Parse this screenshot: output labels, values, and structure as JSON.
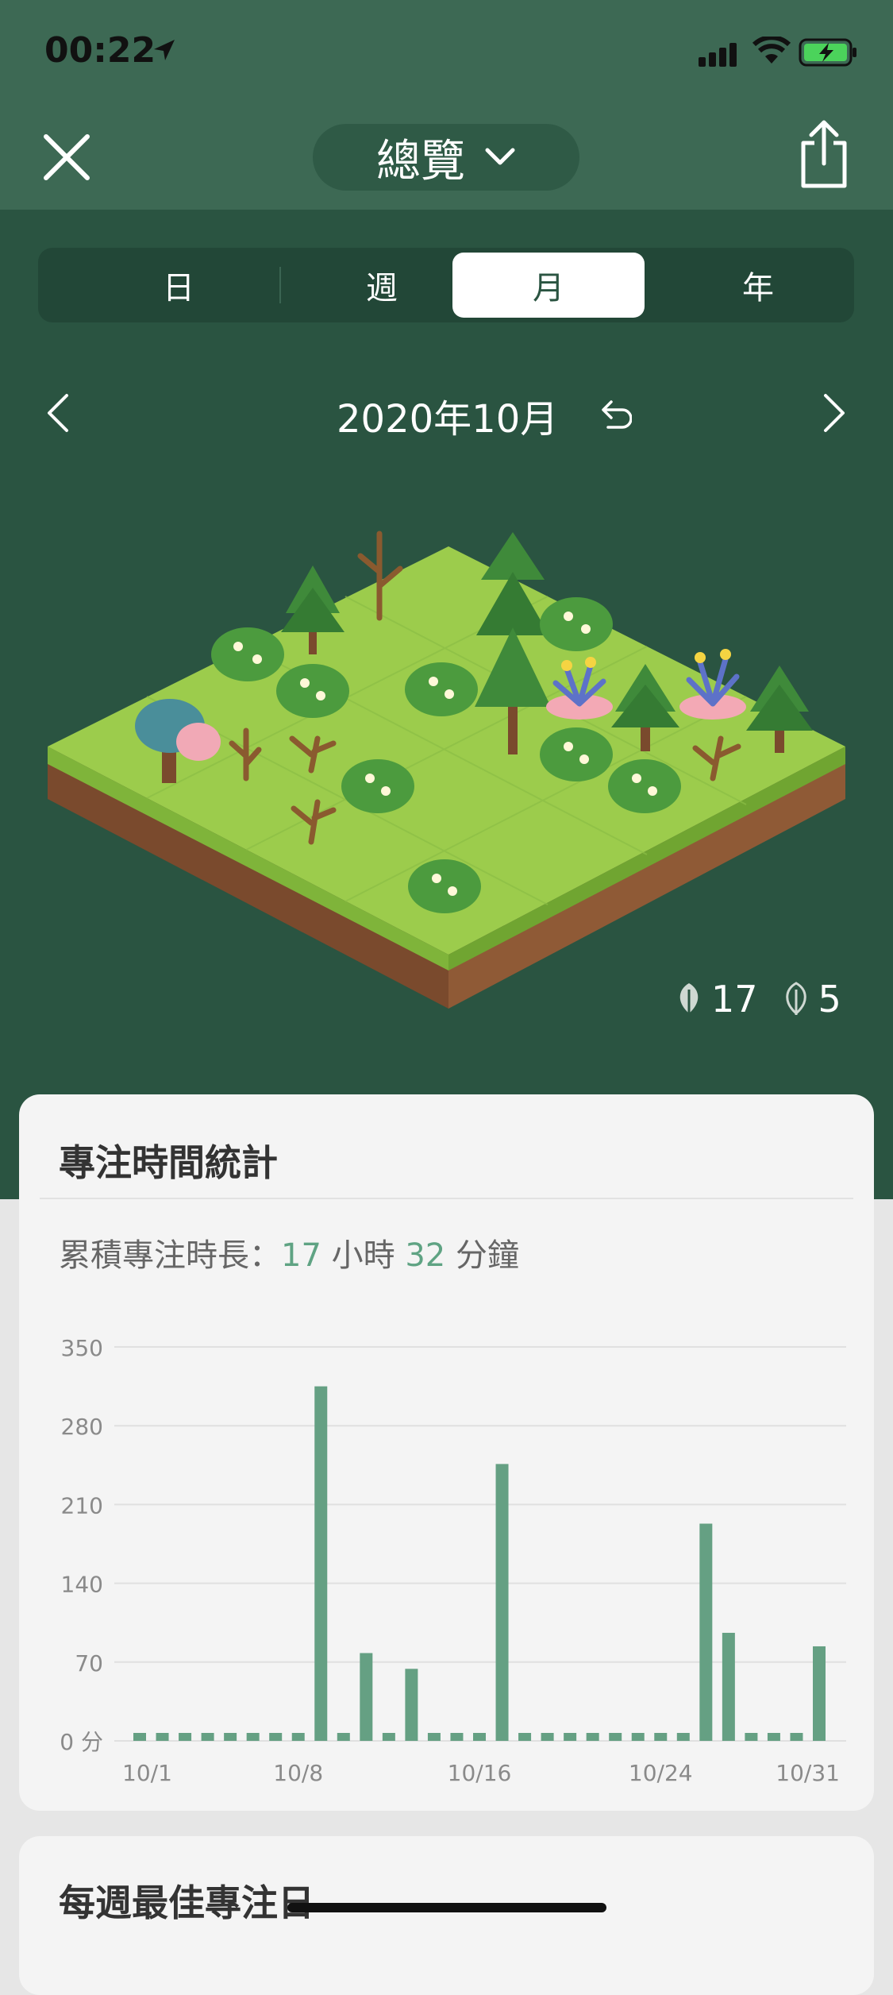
{
  "status_bar": {
    "time": "00:22"
  },
  "header": {
    "title": "總覽"
  },
  "tabs": [
    {
      "label": "日"
    },
    {
      "label": "週"
    },
    {
      "label": "月"
    },
    {
      "label": "年"
    }
  ],
  "date_nav": {
    "label": "2020年10月"
  },
  "counts": {
    "healthy": "17",
    "withered": "5"
  },
  "stats_card": {
    "title": "專注時間統計",
    "summary_prefix": "累積專注時長：",
    "hours": "17",
    "hours_unit": " 小時 ",
    "minutes": "32",
    "minutes_unit": " 分鐘"
  },
  "chart_data": {
    "type": "bar",
    "categories": [
      "10/1",
      "10/2",
      "10/3",
      "10/4",
      "10/5",
      "10/6",
      "10/7",
      "10/8",
      "10/9",
      "10/10",
      "10/11",
      "10/12",
      "10/13",
      "10/14",
      "10/15",
      "10/16",
      "10/17",
      "10/18",
      "10/19",
      "10/20",
      "10/21",
      "10/22",
      "10/23",
      "10/24",
      "10/25",
      "10/26",
      "10/27",
      "10/28",
      "10/29",
      "10/30",
      "10/31"
    ],
    "values": [
      0,
      0,
      0,
      0,
      0,
      0,
      0,
      0,
      315,
      0,
      78,
      0,
      64,
      0,
      0,
      0,
      246,
      0,
      0,
      0,
      0,
      0,
      0,
      0,
      0,
      193,
      96,
      0,
      0,
      0,
      84
    ],
    "ylim": [
      0,
      350
    ],
    "yticks": [
      "350",
      "280",
      "210",
      "140",
      "70",
      "0 分"
    ],
    "xtick_labels": [
      "10/1",
      "10/8",
      "10/16",
      "10/24",
      "10/31"
    ],
    "bar_color": "#65a083",
    "grid": true
  },
  "weekly_card": {
    "title": "每週最佳專注日"
  }
}
